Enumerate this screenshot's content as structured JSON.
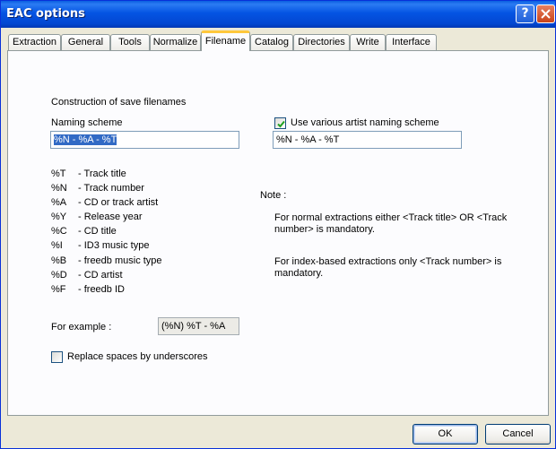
{
  "window": {
    "title": "EAC options"
  },
  "tabs": [
    "Extraction",
    "General",
    "Tools",
    "Normalize",
    "Filename",
    "Catalog",
    "Directories",
    "Write",
    "Interface"
  ],
  "active_tab": "Filename",
  "section_title": "Construction of save filenames",
  "naming": {
    "label": "Naming scheme",
    "value": "%N - %A - %T"
  },
  "various": {
    "label": "Use various artist naming scheme",
    "checked": true,
    "value": "%N - %A - %T"
  },
  "legend": [
    {
      "code": "%T",
      "desc": "- Track title"
    },
    {
      "code": "%N",
      "desc": "- Track number"
    },
    {
      "code": "%A",
      "desc": "- CD or track artist"
    },
    {
      "code": "%Y",
      "desc": "- Release year"
    },
    {
      "code": "%C",
      "desc": "- CD title"
    },
    {
      "code": "%I",
      "desc": "- ID3 music type"
    },
    {
      "code": "%B",
      "desc": "- freedb music type"
    },
    {
      "code": "%D",
      "desc": "- CD artist"
    },
    {
      "code": "%F",
      "desc": "- freedb ID"
    }
  ],
  "note": {
    "title": "Note :",
    "line1a": "For normal extractions either <Track title>  OR  <Track",
    "line1b": "number> is mandatory.",
    "line2a": "For index-based extractions only <Track number> is",
    "line2b": "mandatory."
  },
  "example": {
    "label": "For example :",
    "value": "(%N) %T - %A"
  },
  "replace_spaces": {
    "label": "Replace spaces by underscores",
    "checked": false
  },
  "buttons": {
    "ok": "OK",
    "cancel": "Cancel"
  }
}
